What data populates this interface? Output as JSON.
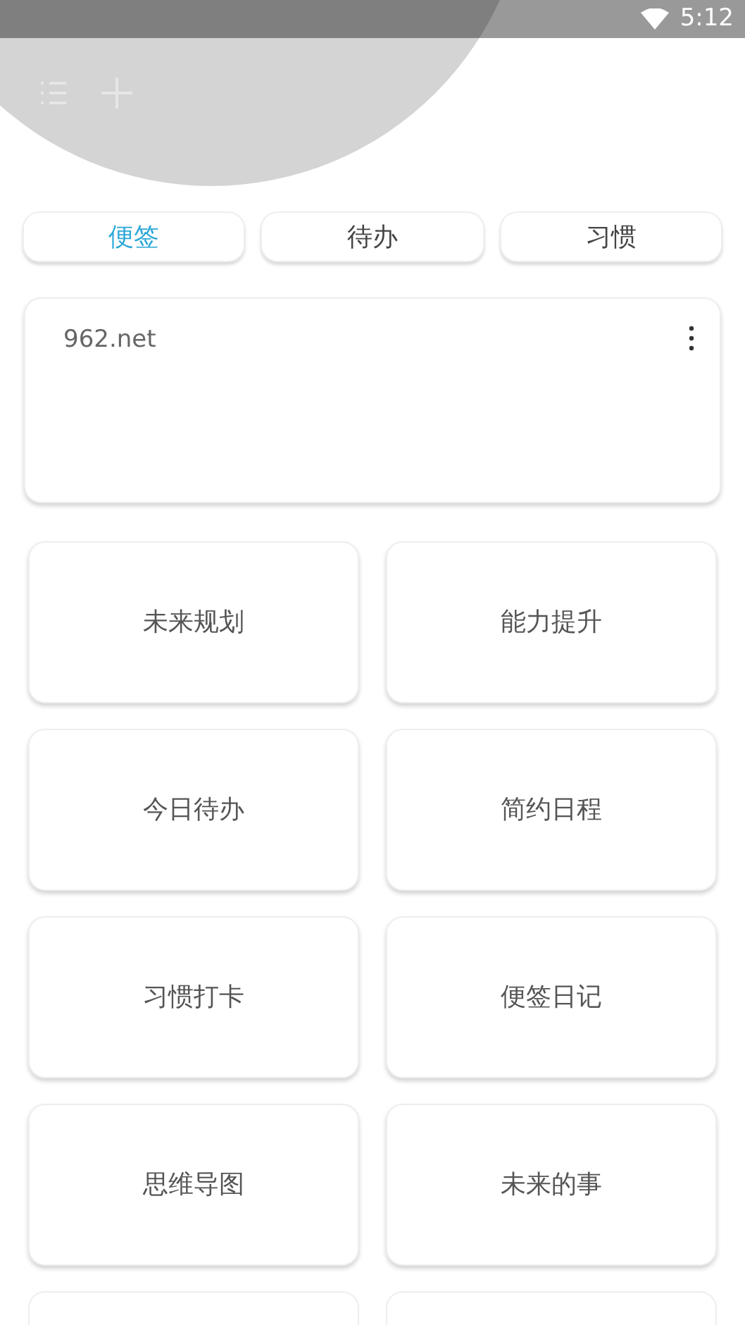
{
  "status_bar": {
    "time": "5:12"
  },
  "tabs": [
    {
      "label": "便签",
      "selected": true
    },
    {
      "label": "待办",
      "selected": false
    },
    {
      "label": "习惯",
      "selected": false
    }
  ],
  "note": {
    "text": "962.net"
  },
  "tiles": [
    {
      "label": "未来规划"
    },
    {
      "label": "能力提升"
    },
    {
      "label": "今日待办"
    },
    {
      "label": "简约日程"
    },
    {
      "label": "习惯打卡"
    },
    {
      "label": "便签日记"
    },
    {
      "label": "思维导图"
    },
    {
      "label": "未来的事"
    }
  ]
}
